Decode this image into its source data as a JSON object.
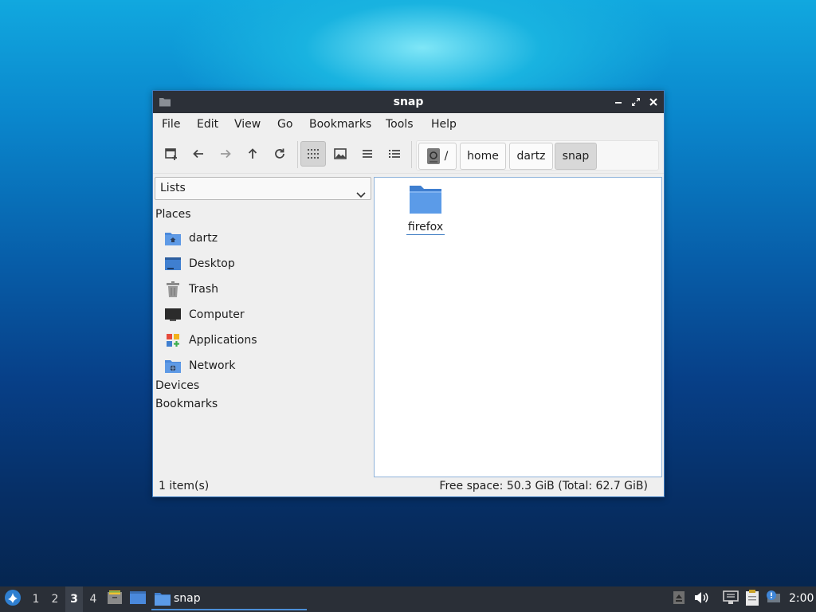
{
  "window": {
    "title": "snap",
    "menu": [
      "File",
      "Edit",
      "View",
      "Go",
      "Bookmarks",
      "Tools",
      "Help"
    ],
    "path": {
      "root": "/",
      "segments": [
        "home",
        "dartz",
        "snap"
      ]
    },
    "sidebar": {
      "mode": "Lists",
      "places_header": "Places",
      "places": [
        {
          "label": "dartz",
          "icon": "home-folder-icon"
        },
        {
          "label": "Desktop",
          "icon": "desktop-icon"
        },
        {
          "label": "Trash",
          "icon": "trash-icon"
        },
        {
          "label": "Computer",
          "icon": "computer-icon"
        },
        {
          "label": "Applications",
          "icon": "applications-icon"
        },
        {
          "label": "Network",
          "icon": "network-folder-icon"
        }
      ],
      "devices_header": "Devices",
      "bookmarks_header": "Bookmarks"
    },
    "files": [
      {
        "name": "firefox",
        "icon": "folder-icon"
      }
    ],
    "status": {
      "count": "1 item(s)",
      "space": "Free space: 50.3 GiB (Total: 62.7 GiB)"
    }
  },
  "taskbar": {
    "workspaces": [
      "1",
      "2",
      "3",
      "4"
    ],
    "current_workspace": "3",
    "task_label": "snap",
    "clock": "2:00"
  },
  "colors": {
    "accent": "#3d7cc2",
    "titlebar": "#2c3038",
    "taskbar": "#2a2f37",
    "folder": "#4a89dc"
  }
}
